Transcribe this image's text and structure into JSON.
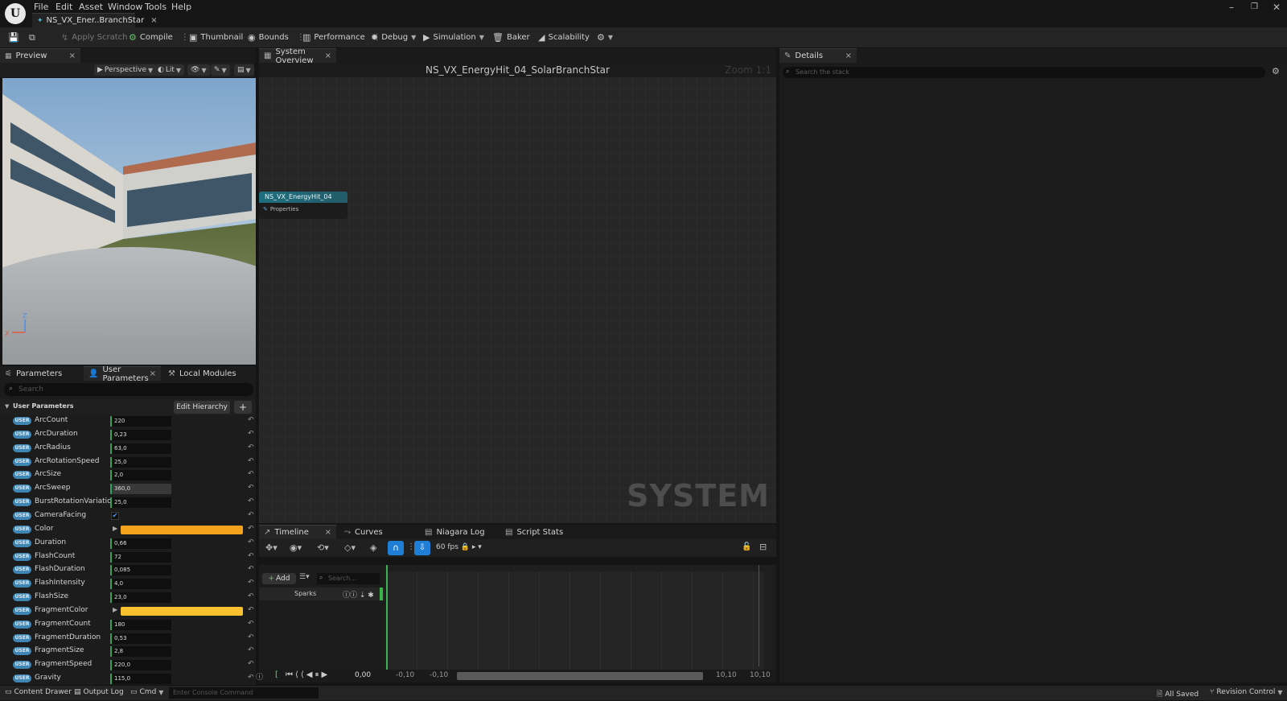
{
  "menu": [
    "File",
    "Edit",
    "Asset",
    "Window",
    "Tools",
    "Help"
  ],
  "document_tab": "NS_VX_Ener..BranchStar",
  "toolbar": {
    "apply_scratch": "Apply Scratch",
    "compile": "Compile",
    "thumbnail": "Thumbnail",
    "bounds": "Bounds",
    "performance": "Performance",
    "debug": "Debug",
    "simulation": "Simulation",
    "baker": "Baker",
    "scalability": "Scalability"
  },
  "preview": {
    "tab": "Preview",
    "perspective": "Perspective",
    "lit": "Lit",
    "axis_z": "Z",
    "axis_x": "X"
  },
  "params": {
    "tabs": [
      "Parameters",
      "User Parameters",
      "Local Modules"
    ],
    "search_placeholder": "Search",
    "group_label": "User Parameters",
    "edit_hierarchy": "Edit Hierarchy",
    "badge": "USER",
    "rows": [
      {
        "name": "ArcCount",
        "value": "220",
        "type": "num"
      },
      {
        "name": "ArcDuration",
        "value": "0,23",
        "type": "num"
      },
      {
        "name": "ArcRadius",
        "value": "63,0",
        "type": "num"
      },
      {
        "name": "ArcRotationSpeed",
        "value": "25,0",
        "type": "num"
      },
      {
        "name": "ArcSize",
        "value": "2,0",
        "type": "num"
      },
      {
        "name": "ArcSweep",
        "value": "360,0",
        "type": "num",
        "highlight": true
      },
      {
        "name": "BurstRotationVariation",
        "value": "25,0",
        "type": "num"
      },
      {
        "name": "CameraFacing",
        "value": "",
        "type": "bool"
      },
      {
        "name": "Color",
        "value": "",
        "type": "color",
        "color": "#f5a21d"
      },
      {
        "name": "Duration",
        "value": "0,66",
        "type": "num"
      },
      {
        "name": "FlashCount",
        "value": "72",
        "type": "num"
      },
      {
        "name": "FlashDuration",
        "value": "0,085",
        "type": "num"
      },
      {
        "name": "FlashIntensity",
        "value": "4,0",
        "type": "num"
      },
      {
        "name": "FlashSize",
        "value": "23,0",
        "type": "num"
      },
      {
        "name": "FragmentColor",
        "value": "",
        "type": "color",
        "color": "#f9c12e"
      },
      {
        "name": "FragmentCount",
        "value": "180",
        "type": "num"
      },
      {
        "name": "FragmentDuration",
        "value": "0,53",
        "type": "num"
      },
      {
        "name": "FragmentSize",
        "value": "2,8",
        "type": "num"
      },
      {
        "name": "FragmentSpeed",
        "value": "220,0",
        "type": "num"
      },
      {
        "name": "Gravity",
        "value": "115,0",
        "type": "num"
      }
    ]
  },
  "graph": {
    "tab": "System Overview",
    "title": "NS_VX_EnergyHit_04_SolarBranchStar",
    "zoom": "Zoom 1:1",
    "node_title": "NS_VX_EnergyHit_04",
    "node_properties": "Properties",
    "watermark": "SYSTEM"
  },
  "timeline": {
    "tabs": [
      "Timeline",
      "Curves",
      "Niagara Log",
      "Script Stats"
    ],
    "fps": "60 fps",
    "add": "Add",
    "search_placeholder": "Search...",
    "track": "Sparks",
    "time": "0,00",
    "range_start_1": "-0,10",
    "range_start_2": "-0,10",
    "range_end_1": "10,10",
    "range_end_2": "10,10"
  },
  "details": {
    "tab": "Details",
    "search_placeholder": "Search the stack"
  },
  "status": {
    "content_drawer": "Content Drawer",
    "output_log": "Output Log",
    "cmd": "Cmd",
    "console_placeholder": "Enter Console Command",
    "all_saved": "All Saved",
    "revision_control": "Revision Control"
  }
}
